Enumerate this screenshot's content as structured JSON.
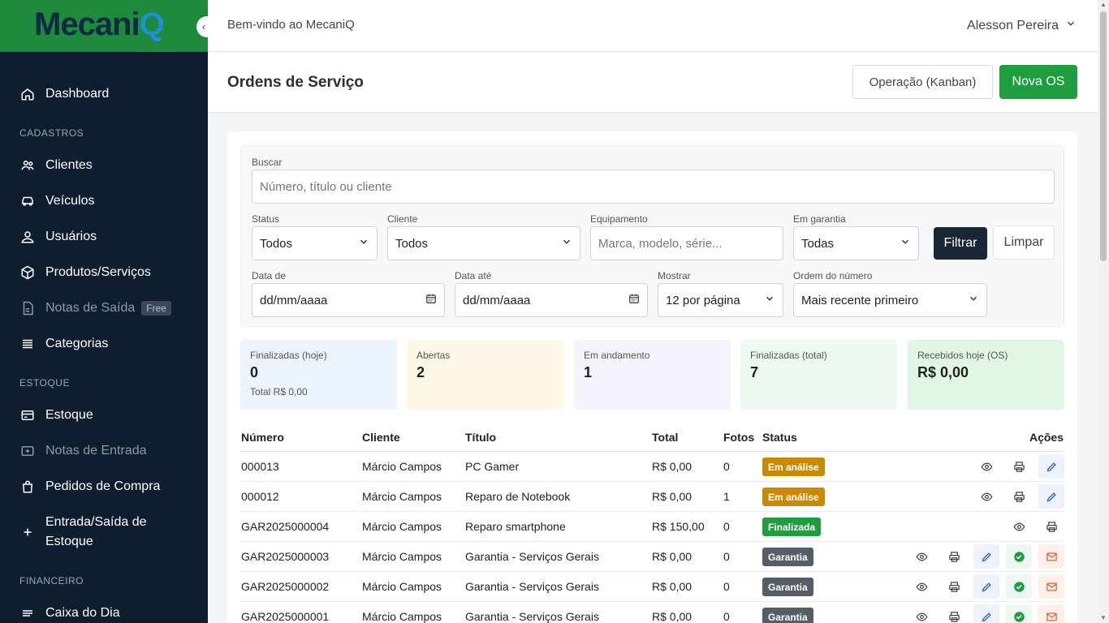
{
  "brand": {
    "logo_text_main": "Mecani",
    "logo_text_q": "Q"
  },
  "sidebar": {
    "items": [
      {
        "label": "Dashboard",
        "icon": "home-icon"
      },
      {
        "label": "Clientes",
        "icon": "users-icon"
      },
      {
        "label": "Veículos",
        "icon": "car-icon"
      },
      {
        "label": "Usuários",
        "icon": "user-icon"
      },
      {
        "label": "Produtos/Serviços",
        "icon": "box-icon"
      },
      {
        "label": "Notas de Saída",
        "icon": "document-icon",
        "badge": "Free"
      },
      {
        "label": "Categorias",
        "icon": "list-icon"
      },
      {
        "label": "Estoque",
        "icon": "inventory-icon"
      },
      {
        "label": "Notas de Entrada",
        "icon": "inbox-icon"
      },
      {
        "label": "Pedidos de Compra",
        "icon": "bag-icon"
      },
      {
        "label": "Entrada/Saída de Estoque",
        "icon": "plus-icon"
      },
      {
        "label": "Caixa do Dia",
        "icon": "menu-icon"
      }
    ],
    "sections": {
      "cadastros": "CADASTROS",
      "estoque": "ESTOQUE",
      "financeiro": "FINANCEIRO"
    }
  },
  "topbar": {
    "welcome": "Bem-vindo ao MecaniQ",
    "user_name": "Alesson Pereira"
  },
  "header": {
    "title": "Ordens de Serviço",
    "kanban_label": "Operação (Kanban)",
    "new_label": "Nova OS"
  },
  "filters": {
    "search_label": "Buscar",
    "search_placeholder": "Número, título ou cliente",
    "status_label": "Status",
    "status_value": "Todos",
    "cliente_label": "Cliente",
    "cliente_value": "Todos",
    "equip_label": "Equipamento",
    "equip_placeholder": "Marca, modelo, série...",
    "garantia_label": "Em garantia",
    "garantia_value": "Todas",
    "filter_button": "Filtrar",
    "clear_button": "Limpar",
    "date_from_label": "Data de",
    "date_from_value": "dd/mm/aaaa",
    "date_to_label": "Data até",
    "date_to_value": "dd/mm/aaaa",
    "show_label": "Mostrar",
    "show_value": "12 por página",
    "order_label": "Ordem do número",
    "order_value": "Mais recente primeiro"
  },
  "stats": [
    {
      "label": "Finalizadas (hoje)",
      "value": "0",
      "sub": "Total R$ 0,00",
      "bg": "#eef4fd"
    },
    {
      "label": "Abertas",
      "value": "2",
      "bg": "#fdf9e6"
    },
    {
      "label": "Em andamento",
      "value": "1",
      "bg": "#f7f3fd"
    },
    {
      "label": "Finalizadas (total)",
      "value": "7",
      "bg": "#eefaf1"
    },
    {
      "label": "Recebidos hoje (OS)",
      "value": "R$ 0,00",
      "bg": "#e0f7e6"
    }
  ],
  "table": {
    "headers": {
      "numero": "Número",
      "cliente": "Cliente",
      "titulo": "Título",
      "total": "Total",
      "fotos": "Fotos",
      "status": "Status",
      "acoes": "Ações"
    },
    "rows": [
      {
        "numero": "000013",
        "cliente": "Márcio Campos",
        "titulo": "PC Gamer",
        "total": "R$ 0,00",
        "fotos": "0",
        "status": "Em análise",
        "status_color": "#c98a00",
        "actions": [
          "view",
          "print",
          "edit"
        ]
      },
      {
        "numero": "000012",
        "cliente": "Márcio Campos",
        "titulo": "Reparo de Notebook",
        "total": "R$ 0,00",
        "fotos": "1",
        "status": "Em análise",
        "status_color": "#c98a00",
        "actions": [
          "view",
          "print",
          "edit"
        ]
      },
      {
        "numero": "GAR2025000004",
        "cliente": "Márcio Campos",
        "titulo": "Reparo smartphone",
        "total": "R$ 150,00",
        "fotos": "0",
        "status": "Finalizada",
        "status_color": "#1e9e3e",
        "actions": [
          "view",
          "print"
        ]
      },
      {
        "numero": "GAR2025000003",
        "cliente": "Márcio Campos",
        "titulo": "Garantia - Serviços Gerais",
        "total": "R$ 0,00",
        "fotos": "0",
        "status": "Garantia",
        "status_color": "#555d66",
        "actions": [
          "view",
          "print",
          "edit",
          "ok",
          "mail"
        ]
      },
      {
        "numero": "GAR2025000002",
        "cliente": "Márcio Campos",
        "titulo": "Garantia - Serviços Gerais",
        "total": "R$ 0,00",
        "fotos": "0",
        "status": "Garantia",
        "status_color": "#555d66",
        "actions": [
          "view",
          "print",
          "edit",
          "ok",
          "mail"
        ]
      },
      {
        "numero": "GAR2025000001",
        "cliente": "Márcio Campos",
        "titulo": "Garantia - Serviços Gerais",
        "total": "R$ 0,00",
        "fotos": "0",
        "status": "Garantia",
        "status_color": "#555d66",
        "actions": [
          "view",
          "print",
          "edit",
          "ok",
          "mail"
        ]
      }
    ]
  },
  "colors": {
    "brand_green": "#1e8a3c",
    "sidebar_bg": "#0f1e2e",
    "primary_green": "#1e9e3e"
  }
}
